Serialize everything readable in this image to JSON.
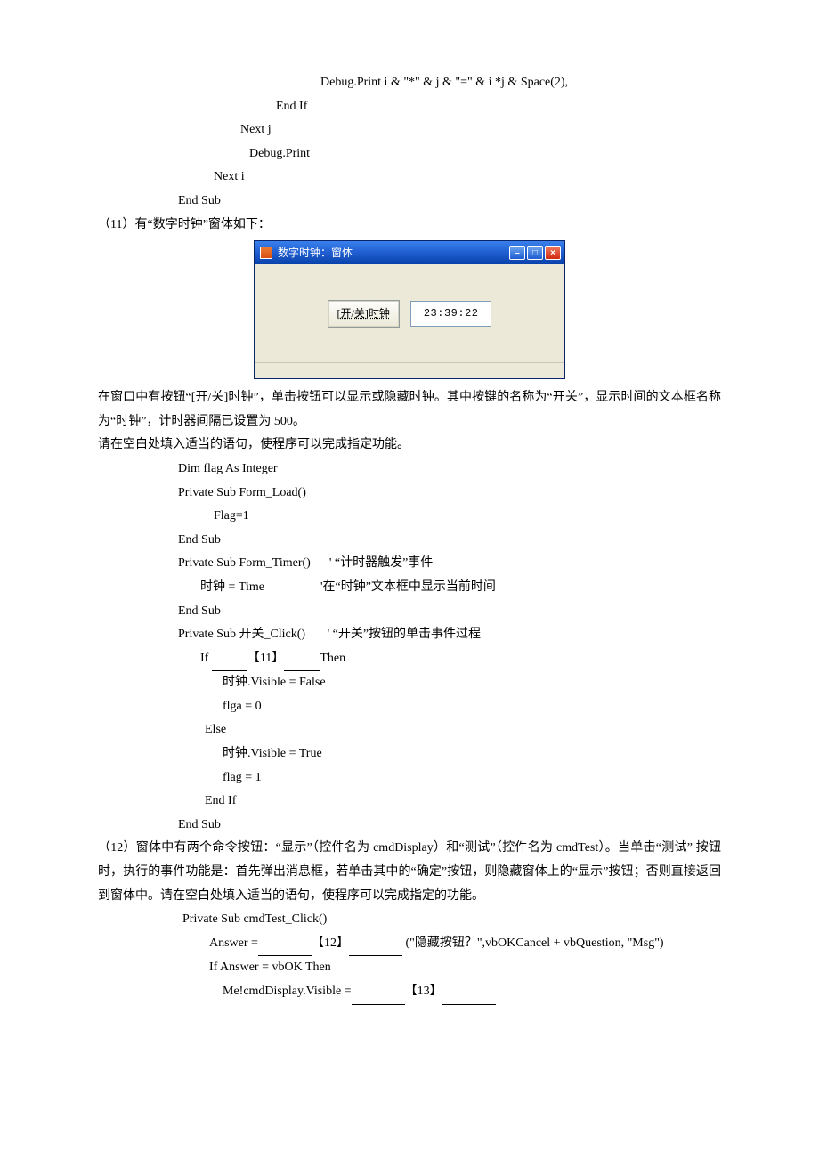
{
  "code_top": {
    "l1": "Debug.Print i & \"*\" & j & \"=\" & i *j & Space(2),",
    "l2": "End If",
    "l3": "Next j",
    "l4": "Debug.Print",
    "l5": "Next i",
    "l6": "End Sub"
  },
  "q11": {
    "heading": "（11）有“数字时钟”窗体如下：",
    "win_title": "数字时钟：窗体",
    "btn_label": "[开/关]时钟",
    "time_value": "23:39:22",
    "min_cap": "–",
    "max_cap": "□",
    "close_cap": "×",
    "para1": "在窗口中有按钮“[开/关]时钟”，单击按钮可以显示或隐藏时钟。其中按键的名称为“开关”，显示时间的文本框名称为“时钟”，计时器间隔已设置为 500。",
    "para2": "请在空白处填入适当的语句，使程序可以完成指定功能。",
    "c1": "Dim flag As Integer",
    "c2": "Private Sub Form_Load()",
    "c3": "Flag=1",
    "c4": "End Sub",
    "c5": "Private Sub Form_Timer()",
    "c5c": "' “计时器触发”事件",
    "c6": "时钟  = Time",
    "c6c": "'在“时钟”文本框中显示当前时间",
    "c7": "End Sub",
    "c8": "Private Sub  开关_Click()",
    "c8c": "' “开关”按钮的单击事件过程",
    "c9a": "If  ",
    "c9b": "【11】",
    "c9c": "Then",
    "c10": "时钟.Visible = False",
    "c11": "flga = 0",
    "c12": "Else",
    "c13": "时钟.Visible = True",
    "c14": "flag = 1",
    "c15": "End If",
    "c16": "End Sub"
  },
  "q12": {
    "para": "（12）窗体中有两个命令按钮：“显示”（控件名为 cmdDisplay）和“测试”（控件名为 cmdTest）。当单击“测试” 按钮时，执行的事件功能是：首先弹出消息框，若单击其中的“确定”按钮，则隐藏窗体上的“显示”按钮；否则直接返回到窗体中。请在空白处填入适当的语句，使程序可以完成指定的功能。",
    "c1": "Private Sub cmdTest_Click()",
    "c2a": "Answer =",
    "c2b": "【12】",
    "c2c": "  (\"隐藏按钮？\",vbOKCancel + vbQuestion, \"Msg\")",
    "c3": "If Answer = vbOK Then",
    "c4a": "Me!cmdDisplay.Visible =",
    "c4b": "【13】"
  }
}
